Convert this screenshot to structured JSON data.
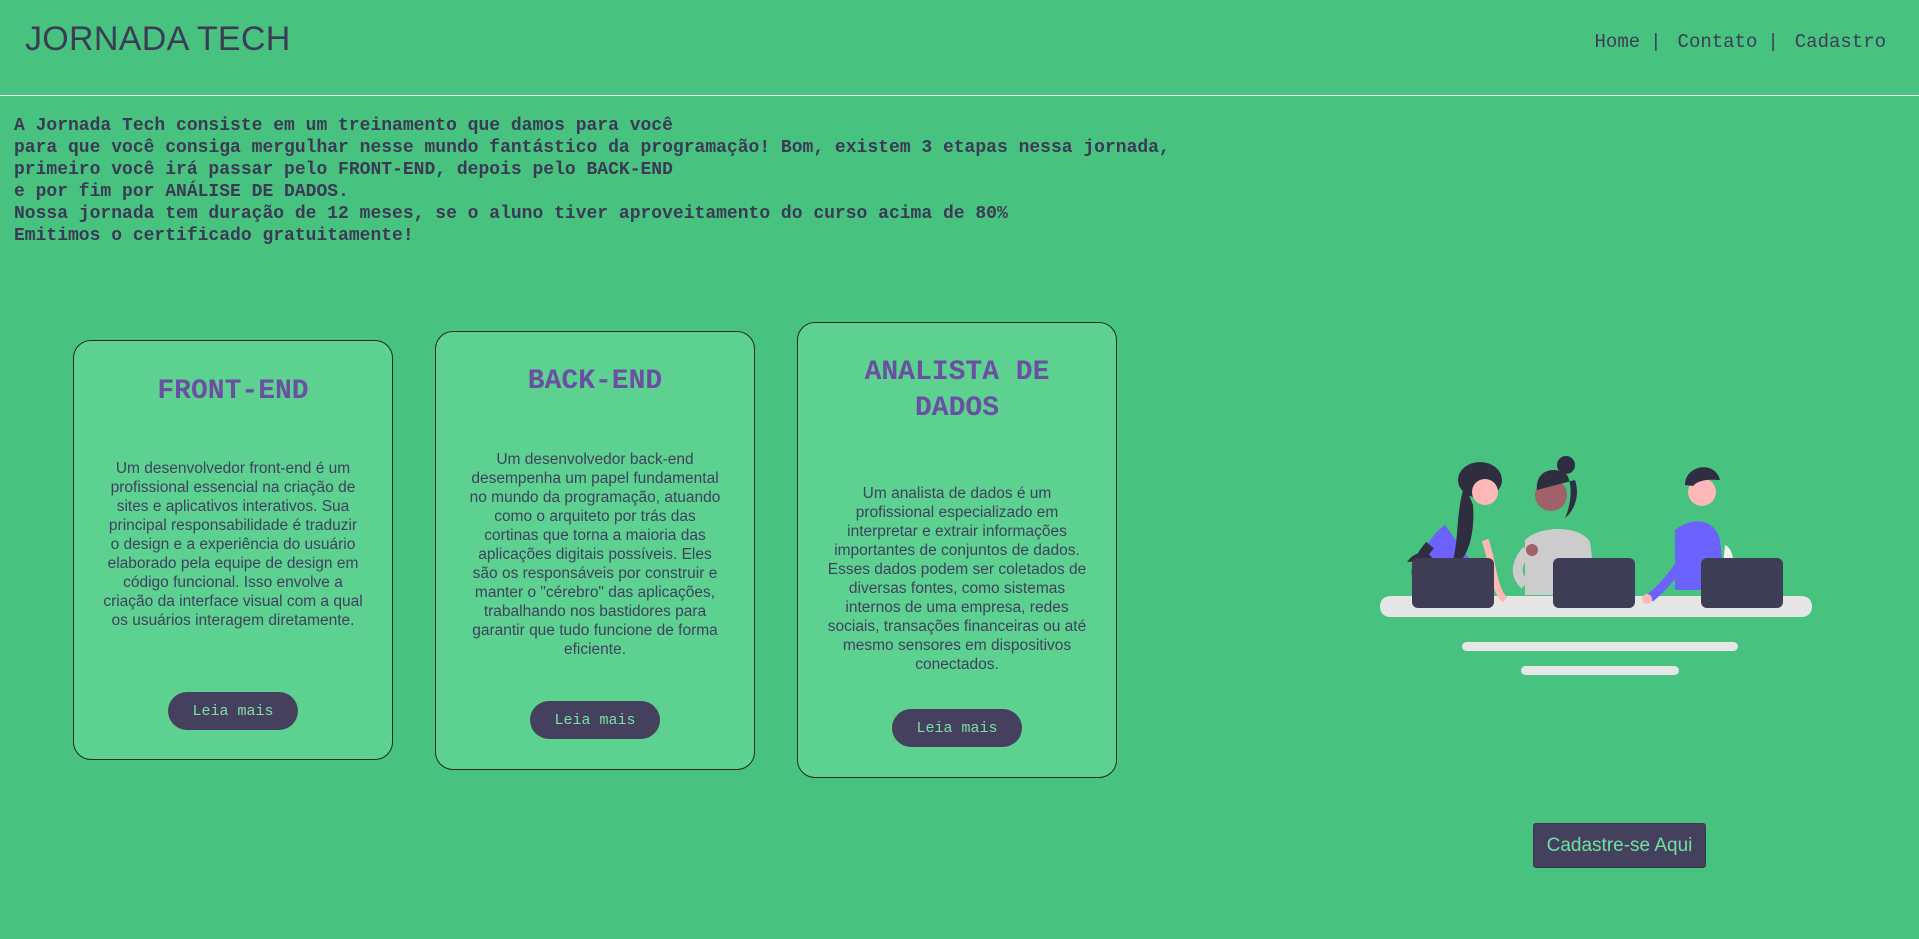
{
  "header": {
    "brand": "JORNADA TECH",
    "nav": [
      {
        "label": "Home"
      },
      {
        "label": "Contato"
      },
      {
        "label": "Cadastro"
      }
    ],
    "separator": "|"
  },
  "intro": {
    "text": "A Jornada Tech consiste em um treinamento que damos para você\npara que você consiga mergulhar nesse mundo fantástico da programação! Bom, existem 3 etapas nessa jornada,\nprimeiro você irá passar pelo FRONT-END, depois pelo BACK-END\ne por fim por ANÁLISE DE DADOS.\nNossa jornada tem duração de 12 meses, se o aluno tiver aproveitamento do curso acima de 80%\nEmitimos o certificado gratuitamente!"
  },
  "cards": [
    {
      "title": "FRONT-END",
      "text": "Um desenvolvedor front-end é um profissional essencial na criação de sites e aplicativos interativos. Sua principal responsabilidade é traduzir o design e a experiência do usuário elaborado pela equipe de design em código funcional. Isso envolve a criação da interface visual com a qual os usuários interagem diretamente.",
      "button": "Leia mais"
    },
    {
      "title": "BACK-END",
      "text": "Um desenvolvedor back-end desempenha um papel fundamental no mundo da programação, atuando como o arquiteto por trás das cortinas que torna a maioria das aplicações digitais possíveis. Eles são os responsáveis por construir e manter o \"cérebro\" das aplicações, trabalhando nos bastidores para garantir que tudo funcione de forma eficiente.",
      "button": "Leia mais"
    },
    {
      "title": "ANALISTA DE DADOS",
      "text": "Um analista de dados é um profissional especializado em interpretar e extrair informações importantes de conjuntos de dados. Esses dados podem ser coletados de diversas fontes, como sistemas internos de uma empresa, redes sociais, transações financeiras ou até mesmo sensores em dispositivos conectados.",
      "button": "Leia mais"
    }
  ],
  "cta": {
    "label": "Cadastre-se Aqui"
  },
  "colors": {
    "background": "#48c27f",
    "card": "#5dd190",
    "accent": "#6a4fa3",
    "button": "#46405f"
  }
}
